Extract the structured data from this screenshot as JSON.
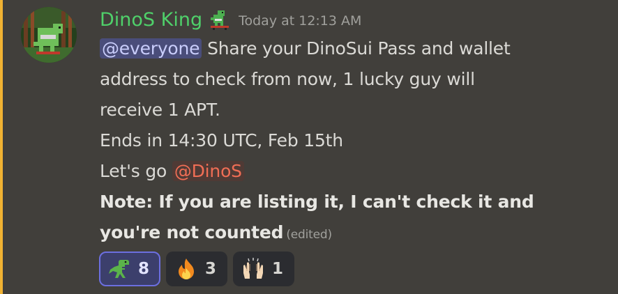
{
  "message": {
    "author": "DinoS King",
    "role_icon": "dinosaur-skateboard-icon",
    "timestamp": "Today at 12:13 AM",
    "line1_mention": "@everyone",
    "line1_text": " Share your DinoSui Pass and wallet",
    "line2": "address to check from now, 1 lucky guy will",
    "line3": "receive 1 APT.",
    "line4": "Ends in 14:30 UTC, Feb 15th",
    "line5_text": "Let's go ",
    "line5_mention": "@DinoS",
    "line6": "Note: If you are listing it, I can't check it and",
    "line7": "you're not counted",
    "edited": "(edited)"
  },
  "reactions": [
    {
      "emoji": "t-rex-icon",
      "count": "8",
      "active": true
    },
    {
      "emoji": "fire-icon",
      "count": "3",
      "active": false
    },
    {
      "emoji": "raising-hands-icon",
      "count": "1",
      "active": false
    }
  ],
  "colors": {
    "background": "#413f3b",
    "highlight_bar": "#f0b232",
    "username": "#4fd06a",
    "mention_everyone_bg": "#4a4d7a",
    "mention_role_text": "#f06e55"
  }
}
